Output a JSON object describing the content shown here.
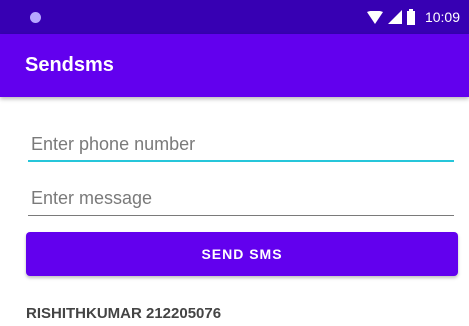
{
  "status_bar": {
    "time": "10:09",
    "background": "#3700b3"
  },
  "app_bar": {
    "title": "Sendsms",
    "background": "#6200ee"
  },
  "form": {
    "phone_placeholder": "Enter phone number",
    "phone_value": "",
    "message_placeholder": "Enter message",
    "message_value": "",
    "send_label": "SEND SMS",
    "focused_underline_color": "#26c6da"
  },
  "footer": {
    "label": "RISHITHKUMAR 212205076"
  }
}
